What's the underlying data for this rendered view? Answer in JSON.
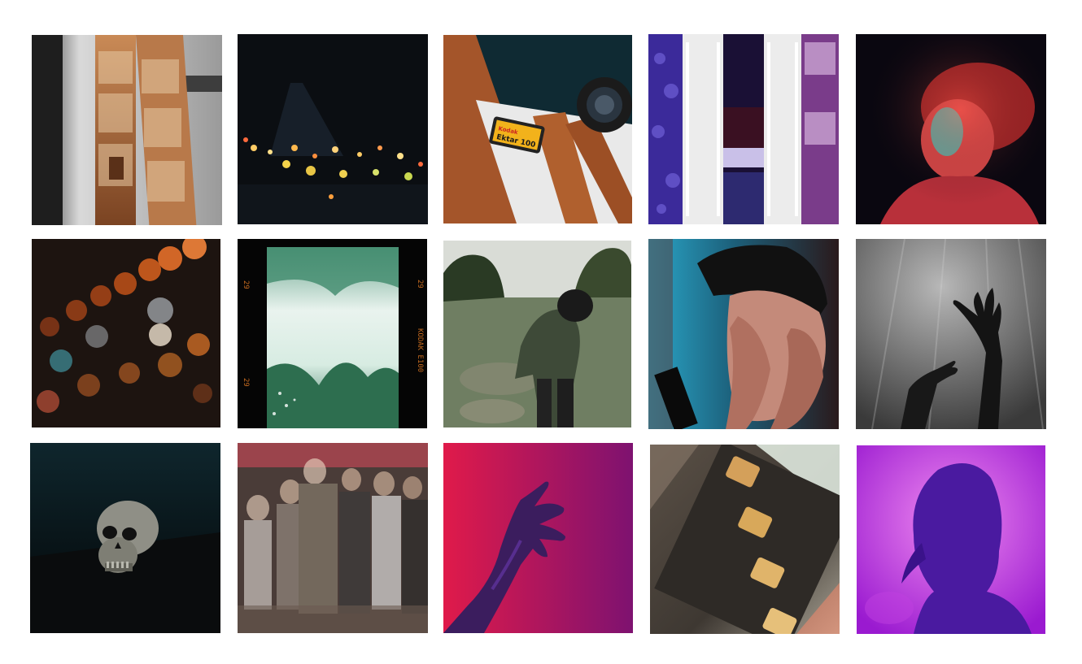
{
  "gallery": {
    "film_canister_brand": "Kodak",
    "film_canister_label": "Ektar 100",
    "film_edge_left": "29",
    "film_edge_bottom_left": "29",
    "film_edge_right": "29",
    "film_edge_right_brand": "KODAK E100"
  },
  "colors": {
    "background": "#ffffff",
    "canister_yellow": "#f2b21b",
    "film_copper": "#b0602e"
  }
}
